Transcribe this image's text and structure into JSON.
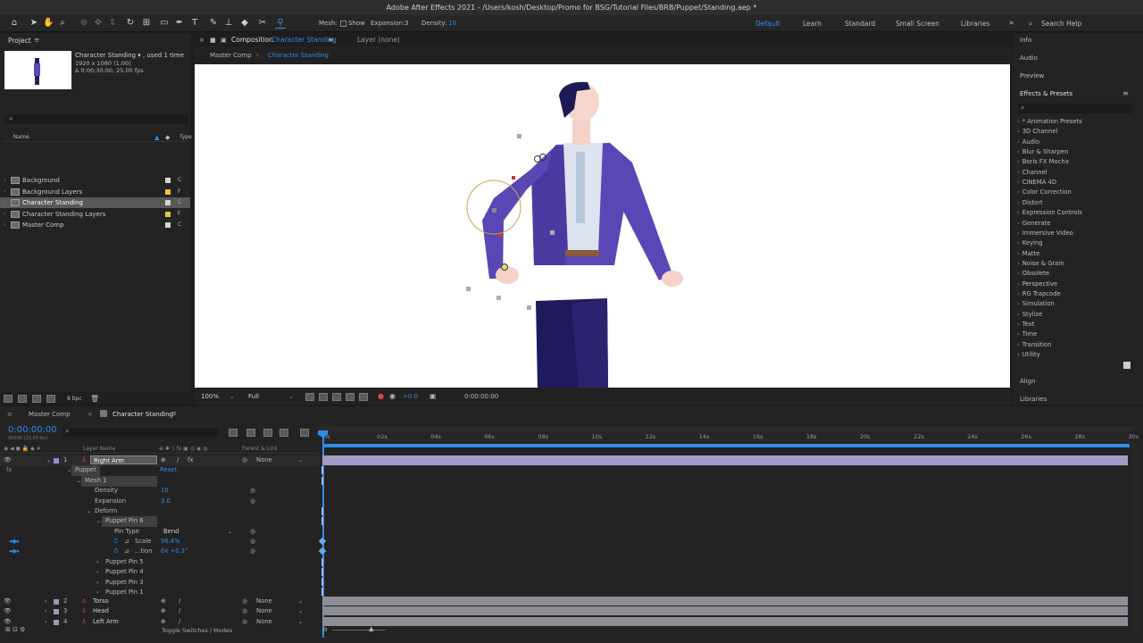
{
  "title": "Adobe After Effects 2021 - /Users/kosh/Desktop/Promo for BSG/Tutorial Files/BRB/Puppet/Standing.aep *",
  "toolbar": {
    "mesh_label": "Mesh:",
    "show_label": "Show",
    "expansion_label": "Expansion:",
    "expansion_value": "3",
    "density_label": "Density:",
    "density_value": "10",
    "workspaces": [
      "Default",
      "Learn",
      "Standard",
      "Small Screen",
      "Libraries"
    ],
    "search_help": "Search Help"
  },
  "project": {
    "title": "Project",
    "item_name": "Character Standing ▾ , used 1 time",
    "item_res": "1920 x 1080 (1.00)",
    "item_dur": "Δ 0;00;30;00, 25.00 fps",
    "col_name": "Name",
    "col_type": "Type",
    "items": [
      {
        "name": "Background",
        "type": "C"
      },
      {
        "name": "Background Layers",
        "type": "F"
      },
      {
        "name": "Character Standing",
        "type": "C"
      },
      {
        "name": "Character Standing Layers",
        "type": "F"
      },
      {
        "name": "Master Comp",
        "type": "C"
      }
    ],
    "bpc": "8 bpc"
  },
  "comp": {
    "tab_prefix": "Composition",
    "tab_name": "Character Standing",
    "layer_tab": "Layer (none)",
    "crumb1": "Master Comp",
    "crumb2": "Character Standing",
    "zoom": "100%",
    "quality": "Full",
    "exposure": "+0.0",
    "timecode": "0:00:00:00"
  },
  "right": {
    "info": "Info",
    "audio": "Audio",
    "preview": "Preview",
    "effects_title": "Effects & Presets",
    "effects": [
      "* Animation Presets",
      "3D Channel",
      "Audio",
      "Blur & Sharpen",
      "Boris FX Mocha",
      "Channel",
      "CINEMA 4D",
      "Color Correction",
      "Distort",
      "Expression Controls",
      "Generate",
      "Immersive Video",
      "Keying",
      "Matte",
      "Noise & Grain",
      "Obsolete",
      "Perspective",
      "RG Trapcode",
      "Simulation",
      "Stylize",
      "Text",
      "Time",
      "Transition",
      "Utility"
    ],
    "align": "Align",
    "libraries": "Libraries"
  },
  "timeline": {
    "tab1": "Master Comp",
    "tab2": "Character Standing",
    "timecode": "0:00:00:00",
    "fps": "00000 (25.00 fps)",
    "col_layer": "Layer Name",
    "col_parent": "Parent & Link",
    "ruler": [
      "0s",
      "02s",
      "04s",
      "06s",
      "08s",
      "10s",
      "12s",
      "14s",
      "16s",
      "18s",
      "20s",
      "22s",
      "24s",
      "26s",
      "28s",
      "30s"
    ],
    "layer1": {
      "num": "1",
      "name": "Right Arm",
      "parent": "None"
    },
    "puppet": "Puppet",
    "reset": "Reset",
    "mesh1": "Mesh 1",
    "density_l": "Density",
    "density_v": "10",
    "expansion_l": "Expansion",
    "expansion_v": "3.0",
    "deform": "Deform",
    "pin6": "Puppet Pin 6",
    "pintype_l": "Pin Type",
    "pintype_v": "Bend",
    "scale_l": "Scale",
    "scale_v": "96.4%",
    "rotation_l": "...tion",
    "rotation_v": "0x +0.3°",
    "pins": [
      "Puppet Pin 5",
      "Puppet Pin 4",
      "Puppet Pin 3",
      "Puppet Pin 1"
    ],
    "layers": [
      {
        "num": "2",
        "name": "Torso",
        "parent": "None"
      },
      {
        "num": "3",
        "name": "Head",
        "parent": "None"
      },
      {
        "num": "4",
        "name": "Left Arm",
        "parent": "None"
      }
    ],
    "toggle": "Toggle Switches / Modes"
  }
}
